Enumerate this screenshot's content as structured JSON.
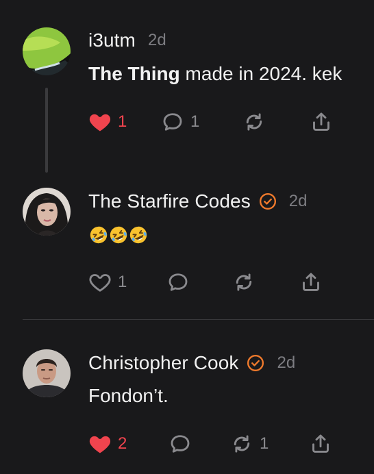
{
  "posts": [
    {
      "username": "i3utm",
      "time": "2d",
      "verified": false,
      "text_bold": "The Thing",
      "text_rest": " made in 2024. kek",
      "liked": true,
      "like_count": "1",
      "reply_count": "1",
      "repost_count": ""
    },
    {
      "username": "The Starfire Codes",
      "time": "2d",
      "verified": true,
      "emoji": [
        "rolling-on-floor-laughing",
        "rolling-on-floor-laughing",
        "rolling-on-floor-laughing"
      ],
      "liked": false,
      "like_count": "1",
      "reply_count": "",
      "repost_count": ""
    },
    {
      "username": "Christopher Cook",
      "time": "2d",
      "verified": true,
      "text": "Fondon’t.",
      "liked": true,
      "like_count": "2",
      "reply_count": "",
      "repost_count": "1"
    }
  ],
  "colors": {
    "background": "#19191b",
    "like_active": "#f0444e",
    "verified_badge": "#f07a2c",
    "muted": "#7d7d82"
  },
  "icons": [
    "heart-icon",
    "comment-icon",
    "repost-icon",
    "share-icon",
    "verified-badge-icon"
  ]
}
